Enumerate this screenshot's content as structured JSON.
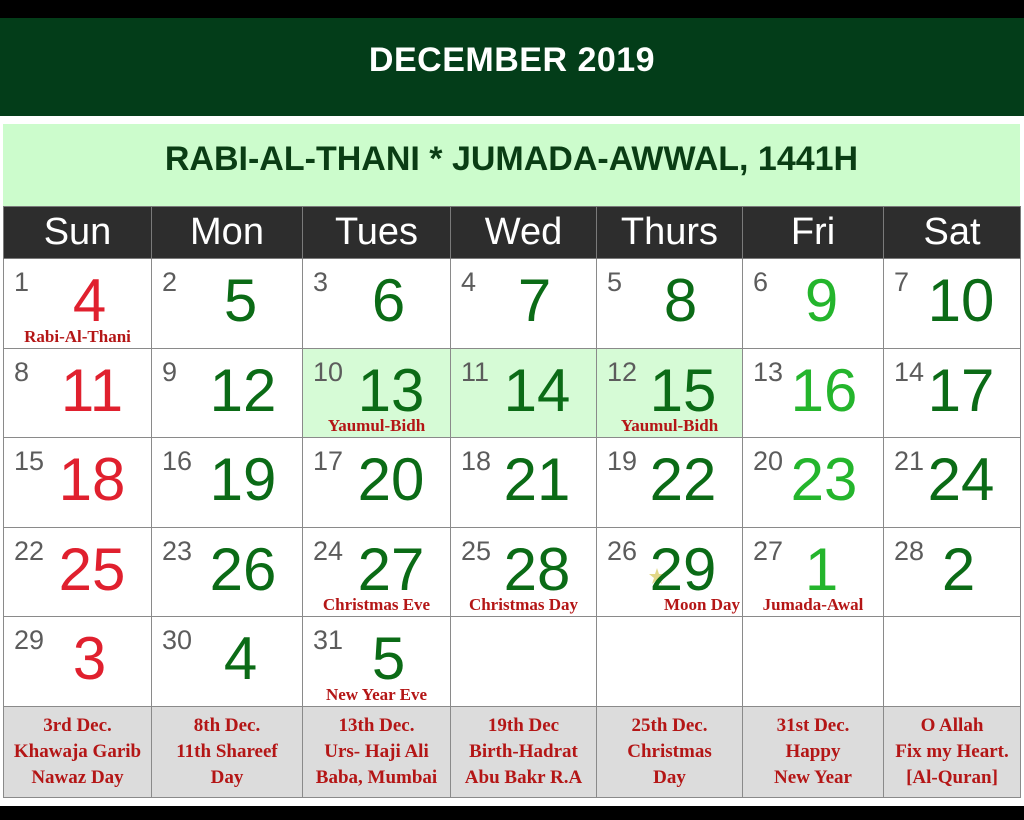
{
  "header": {
    "month_title": "DECEMBER 2019",
    "hijri_title": "RABI-AL-THANI * JUMADA-AWWAL, 1441H"
  },
  "weekdays": [
    "Sun",
    "Mon",
    "Tues",
    "Wed",
    "Thurs",
    "Fri",
    "Sat"
  ],
  "colors": {
    "header_bg": "#033d19",
    "hijri_bg": "#ccfccc",
    "weekday_bg": "#2d2d2d",
    "sunday_number": "#e0202e",
    "friday_number": "#24b52c",
    "weekday_number": "#0b6b16",
    "highlight_cell": "#d6fbd6",
    "note_text": "#b41616",
    "footer_bg": "#dcdcdc"
  },
  "weeks": [
    [
      {
        "greg": "1",
        "hijri": "4",
        "note": "Rabi-Al-Thani"
      },
      {
        "greg": "2",
        "hijri": "5",
        "note": ""
      },
      {
        "greg": "3",
        "hijri": "6",
        "note": ""
      },
      {
        "greg": "4",
        "hijri": "7",
        "note": ""
      },
      {
        "greg": "5",
        "hijri": "8",
        "note": ""
      },
      {
        "greg": "6",
        "hijri": "9",
        "note": ""
      },
      {
        "greg": "7",
        "hijri": "10",
        "note": ""
      }
    ],
    [
      {
        "greg": "8",
        "hijri": "11",
        "note": ""
      },
      {
        "greg": "9",
        "hijri": "12",
        "note": ""
      },
      {
        "greg": "10",
        "hijri": "13",
        "note": "Yaumul-Bidh",
        "highlight": true
      },
      {
        "greg": "11",
        "hijri": "14",
        "note": "",
        "highlight": true
      },
      {
        "greg": "12",
        "hijri": "15",
        "note": "Yaumul-Bidh",
        "highlight": true
      },
      {
        "greg": "13",
        "hijri": "16",
        "note": ""
      },
      {
        "greg": "14",
        "hijri": "17",
        "note": ""
      }
    ],
    [
      {
        "greg": "15",
        "hijri": "18",
        "note": ""
      },
      {
        "greg": "16",
        "hijri": "19",
        "note": ""
      },
      {
        "greg": "17",
        "hijri": "20",
        "note": ""
      },
      {
        "greg": "18",
        "hijri": "21",
        "note": ""
      },
      {
        "greg": "19",
        "hijri": "22",
        "note": ""
      },
      {
        "greg": "20",
        "hijri": "23",
        "note": ""
      },
      {
        "greg": "21",
        "hijri": "24",
        "note": ""
      }
    ],
    [
      {
        "greg": "22",
        "hijri": "25",
        "note": ""
      },
      {
        "greg": "23",
        "hijri": "26",
        "note": ""
      },
      {
        "greg": "24",
        "hijri": "27",
        "note": "Christmas Eve"
      },
      {
        "greg": "25",
        "hijri": "28",
        "note": "Christmas Day"
      },
      {
        "greg": "26",
        "hijri": "29",
        "note": "Moon Day",
        "icon": "crescent-moon-star-icon"
      },
      {
        "greg": "27",
        "hijri": "1",
        "note": "Jumada-Awal"
      },
      {
        "greg": "28",
        "hijri": "2",
        "note": ""
      }
    ],
    [
      {
        "greg": "29",
        "hijri": "3",
        "note": ""
      },
      {
        "greg": "30",
        "hijri": "4",
        "note": ""
      },
      {
        "greg": "31",
        "hijri": "5",
        "note": "New Year Eve"
      },
      {
        "greg": "",
        "hijri": "",
        "note": ""
      },
      {
        "greg": "",
        "hijri": "",
        "note": ""
      },
      {
        "greg": "",
        "hijri": "",
        "note": ""
      },
      {
        "greg": "",
        "hijri": "",
        "note": ""
      }
    ]
  ],
  "footer": [
    [
      "3rd Dec.",
      "Khawaja Garib",
      "Nawaz Day"
    ],
    [
      "8th Dec.",
      "11th Shareef",
      "Day"
    ],
    [
      "13th Dec.",
      "Urs- Haji Ali",
      "Baba, Mumbai"
    ],
    [
      "19th Dec",
      "Birth-Hadrat",
      "Abu Bakr R.A"
    ],
    [
      "25th Dec.",
      "Christmas",
      "Day"
    ],
    [
      "31st Dec.",
      "Happy",
      "New Year"
    ],
    [
      "O Allah",
      "Fix my Heart.",
      "[Al-Quran]"
    ]
  ]
}
